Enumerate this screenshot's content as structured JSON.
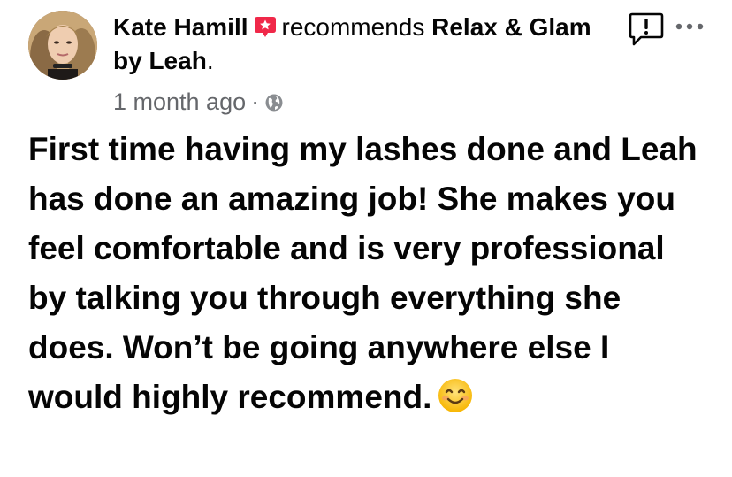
{
  "post": {
    "author": "Kate Hamill",
    "verb": "recommends",
    "page_name": "Relax & Glam by Leah",
    "page_suffix": ".",
    "timestamp": "1 month ago",
    "separator": "·",
    "privacy_icon": "globe-icon",
    "recommend_icon": "recommend-badge-icon",
    "report_icon": "report-icon",
    "more_icon": "more-options-icon",
    "review": "First time having my lashes done and Leah has done an amazing job! She makes you feel comfortable and is very professional by talking you through everything she does. Won’t be going anywhere else I would highly recommend.",
    "emoji": "smiling-face-icon"
  },
  "colors": {
    "recommend_badge": "#f02849",
    "secondary_text": "#65676b",
    "primary_text": "#050505",
    "background": "#ffffff"
  }
}
